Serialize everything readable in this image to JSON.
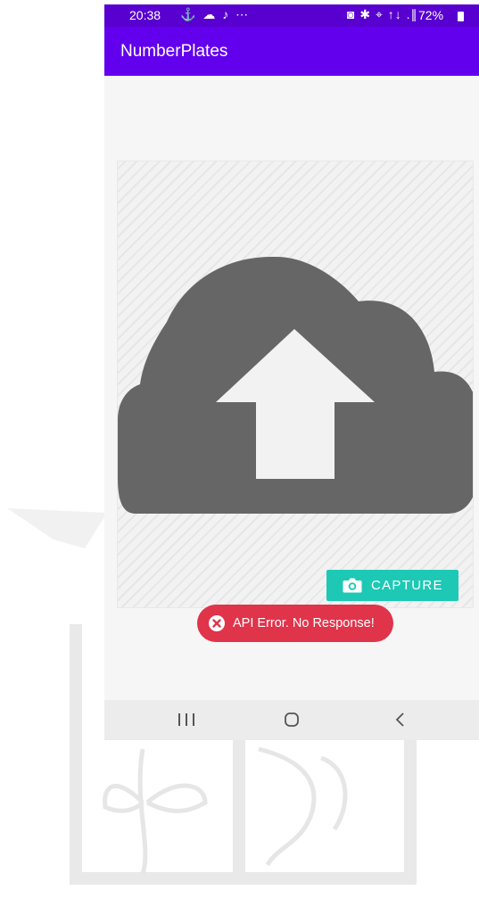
{
  "status_bar": {
    "time": "20:38",
    "left_icons": "⚓ ☁ ♪ ⋯",
    "right_icons": "◙ ✱ ⌖ ↑↓ .∥",
    "battery": "72%",
    "icons": [
      "sync-icon",
      "cloud-icon",
      "music-icon",
      "more-icon",
      "nfc-icon",
      "bluetooth-icon",
      "location-icon",
      "signal-icon",
      "battery-icon"
    ]
  },
  "app": {
    "title": "NumberPlates"
  },
  "main": {
    "capture_label": "CAPTURE",
    "illustration": "cloud-upload-icon"
  },
  "toast": {
    "message": "API Error. No Response!"
  },
  "nav": {
    "recent": "recent-apps-icon",
    "home": "home-icon",
    "back": "back-icon"
  },
  "colors": {
    "app_bar": "#6200ee",
    "status_bar": "#5800cf",
    "capture": "#1dc9b4",
    "error": "#e0344b",
    "cloud": "#666666"
  }
}
